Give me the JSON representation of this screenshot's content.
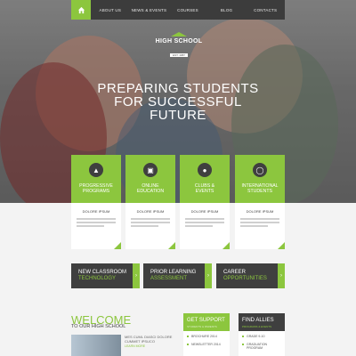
{
  "nav": {
    "items": [
      "ABOUT US",
      "NEWS & EVENTS",
      "COURSES",
      "BLOG",
      "CONTACTS"
    ]
  },
  "logo": {
    "name": "HIGH SCHOOL",
    "est": "EST. 1987"
  },
  "hero": {
    "headline_1": "PREPARING STUDENTS",
    "headline_2": "FOR SUCCESSFUL",
    "headline_3": "FUTURE"
  },
  "cards": [
    {
      "title_1": "PROGRESSIVE",
      "title_2": "PROGRAMS",
      "sub": "DOLORE IPSUM",
      "icon": "graduation-cap-icon"
    },
    {
      "title_1": "ONLINE",
      "title_2": "EDUCATION",
      "sub": "DOLORE IPSUM",
      "icon": "monitor-icon"
    },
    {
      "title_1": "CLUBS &",
      "title_2": "EVENTS",
      "sub": "DOLORE IPSUM",
      "icon": "people-icon"
    },
    {
      "title_1": "INTERNATIONAL",
      "title_2": "STUDENTS",
      "sub": "DOLORE IPSUM",
      "icon": "globe-icon"
    }
  ],
  "banners": [
    {
      "line1": "NEW CLASSROOM",
      "line2": "TECHNOLOGY"
    },
    {
      "line1": "PRIOR LEARNING",
      "line2": "ASSESSMENT"
    },
    {
      "line1": "CAREER",
      "line2": "OPPORTUNITIES"
    }
  ],
  "welcome": {
    "title": "WELCOME",
    "subtitle": "TO OUR HIGH SCHOOL",
    "text": "MES CUML DIASCI DOLORE CUMMET IPSUCO",
    "link": "LEARN MORE"
  },
  "support": {
    "title": "GET SUPPORT",
    "subtitle": "STUDENTS & PARENTS",
    "items": [
      "BROCHURE 2014",
      "NEWSLETTER 2014"
    ]
  },
  "allies": {
    "title": "FIND ALLIES",
    "subtitle": "PROGRAMS & EVENTS",
    "items": [
      "GRADE 9-10",
      "GRADUATION PROGRAM"
    ]
  },
  "colors": {
    "accent": "#8cc63e",
    "dark": "#3f3f3f",
    "nav": "#3c3c3c"
  }
}
